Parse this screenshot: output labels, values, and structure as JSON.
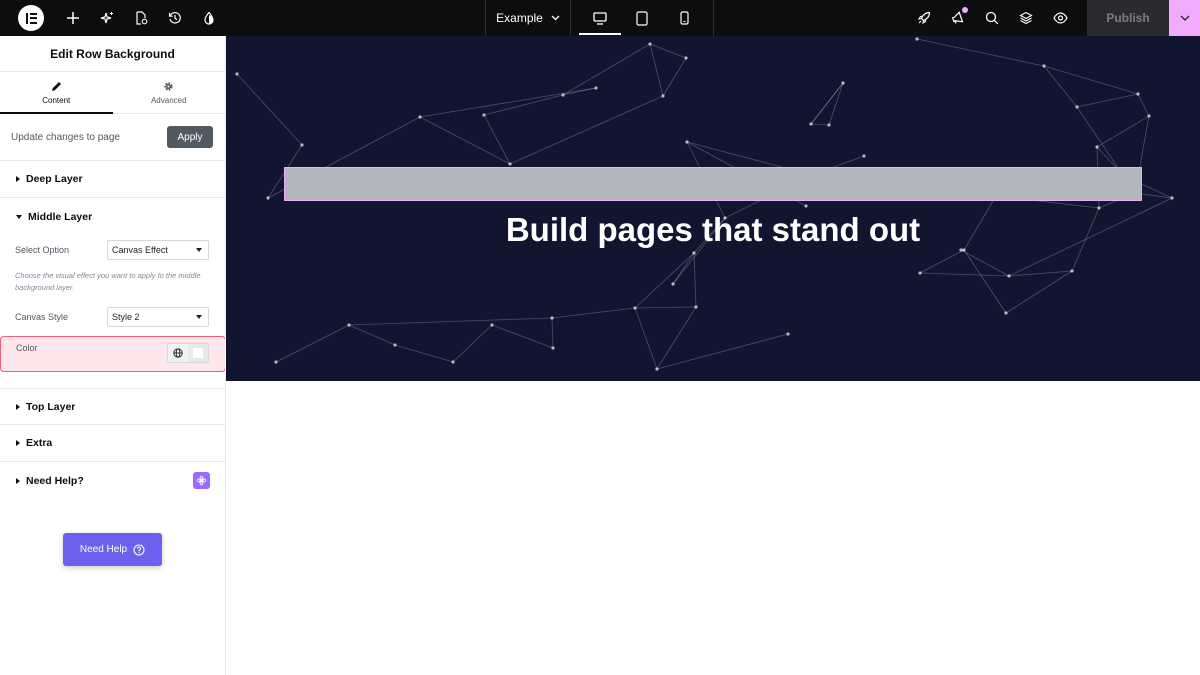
{
  "topbar": {
    "page_name": "Example",
    "publish_label": "Publish",
    "icons": [
      "elementor-logo-icon",
      "plus-icon",
      "sparkle-icon",
      "page-settings-icon",
      "history-icon",
      "drop-icon",
      "desktop-icon",
      "tablet-icon",
      "mobile-icon",
      "rocket-icon",
      "megaphone-icon",
      "search-icon",
      "layers-icon",
      "eye-icon",
      "chevron-down-icon"
    ],
    "accent": "#f0abfc"
  },
  "panel": {
    "title": "Edit Row Background",
    "tabs": [
      {
        "label": "Content"
      },
      {
        "label": "Advanced"
      }
    ],
    "update_text": "Update changes to page",
    "apply_label": "Apply",
    "sections": {
      "deep": "Deep Layer",
      "middle": "Middle Layer",
      "top": "Top Layer",
      "extra": "Extra",
      "help": "Need Help?"
    },
    "select_option_label": "Select Option",
    "select_option_value": "Canvas Effect",
    "select_option_desc": "Choose the visual effect you want to apply to the middle background layer.",
    "canvas_style_label": "Canvas Style",
    "canvas_style_value": "Style 2",
    "color_label": "Color",
    "need_help_button": "Need Help",
    "highlight_color": "#f05b79",
    "button_color": "#6a62ef"
  },
  "canvas": {
    "heading": "Build pages that stand out",
    "background": "#111530"
  }
}
